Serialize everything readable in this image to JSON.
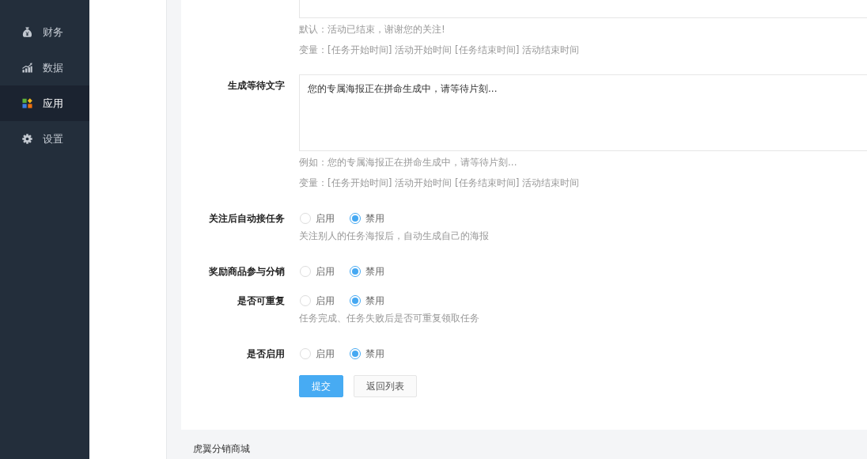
{
  "sidebar": {
    "items": [
      {
        "label": "财务",
        "selected": false
      },
      {
        "label": "数据",
        "selected": false
      },
      {
        "label": "应用",
        "selected": true
      },
      {
        "label": "设置",
        "selected": false
      }
    ]
  },
  "form": {
    "fields": [
      {
        "kind": "textarea",
        "hints": [
          "默认：活动已结束，谢谢您的关注!",
          "变量：[任务开始时间] 活动开始时间 [任务结束时间] 活动结束时间"
        ]
      },
      {
        "kind": "textarea",
        "label": "生成等待文字",
        "value": "您的专属海报正在拼命生成中，请等待片刻...",
        "hints": [
          "例如：您的专属海报正在拼命生成中，请等待片刻...",
          "变量：[任务开始时间] 活动开始时间 [任务结束时间] 活动结束时间"
        ]
      },
      {
        "kind": "radio",
        "label": "关注后自动接任务",
        "options": [
          {
            "label": "启用",
            "selected": false
          },
          {
            "label": "禁用",
            "selected": true
          }
        ],
        "hints": [
          "关注别人的任务海报后，自动生成自己的海报"
        ]
      },
      {
        "kind": "radio",
        "label": "奖励商品参与分销",
        "options": [
          {
            "label": "启用",
            "selected": false
          },
          {
            "label": "禁用",
            "selected": true
          }
        ]
      },
      {
        "kind": "radio",
        "label": "是否可重复",
        "options": [
          {
            "label": "启用",
            "selected": false
          },
          {
            "label": "禁用",
            "selected": true
          }
        ],
        "hints": [
          "任务完成、任务失败后是否可重复领取任务"
        ]
      },
      {
        "kind": "radio",
        "label": "是否启用",
        "options": [
          {
            "label": "启用",
            "selected": false
          },
          {
            "label": "禁用",
            "selected": true
          }
        ]
      }
    ],
    "buttons": [
      {
        "label": "提交",
        "kind": "primary"
      },
      {
        "label": "返回列表",
        "kind": "default"
      }
    ]
  },
  "footer": {
    "text": "虎翼分销商城"
  }
}
